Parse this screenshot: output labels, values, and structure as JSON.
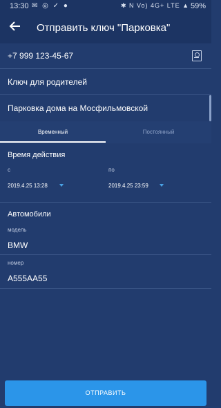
{
  "status_bar": {
    "time": "13:30",
    "left_icons": "✉ ◎ ✓ ●",
    "right_icons": "✱ N Vo) 4G+ LTE ▲",
    "battery": "59%"
  },
  "header": {
    "title": "Отправить ключ \"Парковка\""
  },
  "form": {
    "phone": "+7 999 123-45-67",
    "key_name": "Ключ для родителей",
    "parking": "Парковка дома на Мосфильмовской"
  },
  "tabs": [
    {
      "label": "Временный",
      "active": true
    },
    {
      "label": "Постоянный",
      "active": false
    }
  ],
  "validity": {
    "title": "Время действия",
    "from_label": "с",
    "from_value": "2019.4.25 13:28",
    "to_label": "по",
    "to_value": "2019.4.25 23:59"
  },
  "cars": {
    "title": "Автомобили",
    "model_label": "модель",
    "model_value": "BMW",
    "number_label": "номер",
    "number_value": "A555AA55"
  },
  "actions": {
    "send_label": "ОТПРАВИТЬ"
  },
  "colors": {
    "background": "#223c6e",
    "appbar": "#1c3463",
    "accent": "#2b95e9"
  }
}
